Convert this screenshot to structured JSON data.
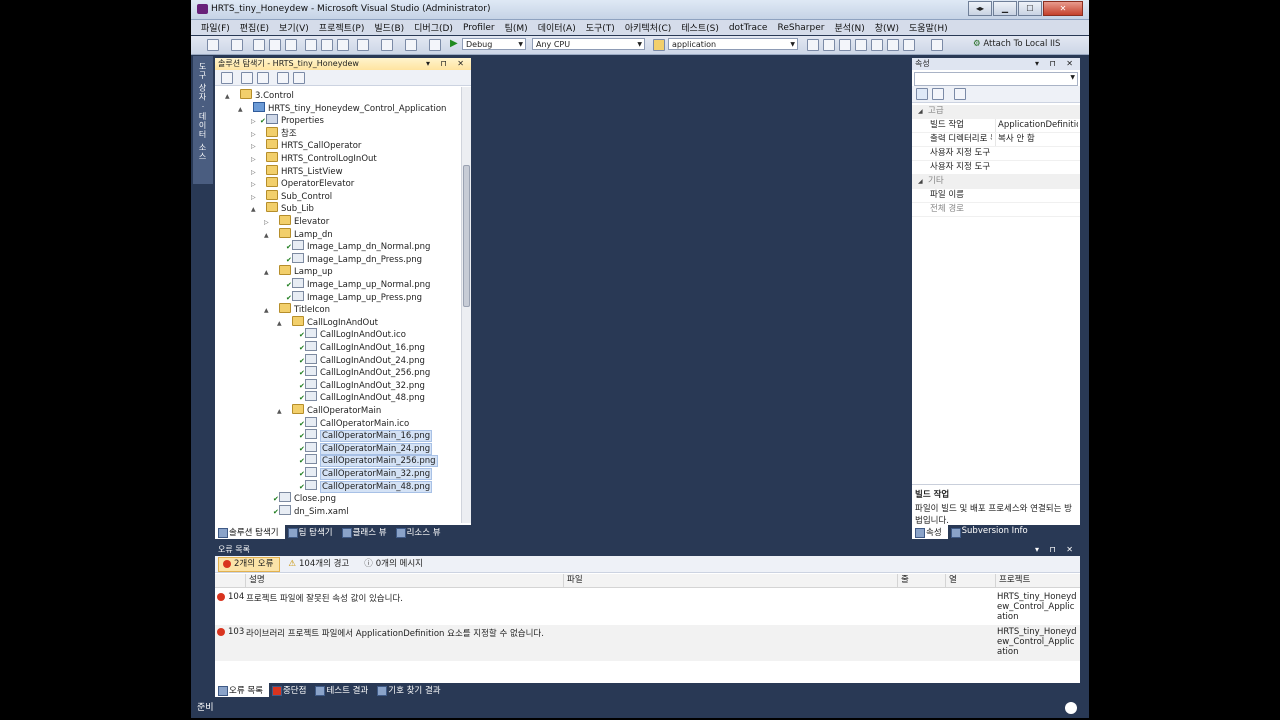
{
  "window": {
    "title": "HRTS_tiny_Honeydew - Microsoft Visual Studio (Administrator)"
  },
  "menu": [
    "파일(F)",
    "편집(E)",
    "보기(V)",
    "프로젝트(P)",
    "빌드(B)",
    "디버그(D)",
    "Profiler",
    "팀(M)",
    "데이터(A)",
    "도구(T)",
    "아키텍처(C)",
    "테스트(S)",
    "dotTrace",
    "ReSharper",
    "분석(N)",
    "창(W)",
    "도움말(H)"
  ],
  "toolbar": {
    "config": "Debug",
    "platform": "Any CPU",
    "find": "application",
    "attach": "Attach To Local IIS"
  },
  "left_dock": {
    "label": "도구 상자 · 데이터 소스"
  },
  "solution_explorer": {
    "title": "솔루션 탐색기 - HRTS_tiny_Honeydew",
    "items": [
      {
        "label": "3.Control",
        "level": 1,
        "icon": "folder",
        "exp": "▲",
        "chk": ""
      },
      {
        "label": "HRTS_tiny_Honeydew_Control_Application",
        "level": 2,
        "icon": "proj",
        "exp": "▲",
        "chk": ""
      },
      {
        "label": "Properties",
        "level": 3,
        "icon": "props",
        "exp": "▷",
        "chk": "✔"
      },
      {
        "label": "참조",
        "level": 3,
        "icon": "folder",
        "exp": "▷",
        "chk": ""
      },
      {
        "label": "HRTS_CallOperator",
        "level": 3,
        "icon": "folder",
        "exp": "▷",
        "chk": ""
      },
      {
        "label": "HRTS_ControlLogInOut",
        "level": 3,
        "icon": "folder",
        "exp": "▷",
        "chk": ""
      },
      {
        "label": "HRTS_ListView",
        "level": 3,
        "icon": "folder",
        "exp": "▷",
        "chk": ""
      },
      {
        "label": "OperatorElevator",
        "level": 3,
        "icon": "folder",
        "exp": "▷",
        "chk": ""
      },
      {
        "label": "Sub_Control",
        "level": 3,
        "icon": "folder",
        "exp": "▷",
        "chk": ""
      },
      {
        "label": "Sub_Lib",
        "level": 3,
        "icon": "folder",
        "exp": "▲",
        "chk": ""
      },
      {
        "label": "Elevator",
        "level": 4,
        "icon": "folder",
        "exp": "▷",
        "chk": ""
      },
      {
        "label": "Lamp_dn",
        "level": 4,
        "icon": "folder",
        "exp": "▲",
        "chk": ""
      },
      {
        "label": "Image_Lamp_dn_Normal.png",
        "level": 5,
        "icon": "file",
        "exp": "",
        "chk": "✔"
      },
      {
        "label": "Image_Lamp_dn_Press.png",
        "level": 5,
        "icon": "file",
        "exp": "",
        "chk": "✔"
      },
      {
        "label": "Lamp_up",
        "level": 4,
        "icon": "folder",
        "exp": "▲",
        "chk": ""
      },
      {
        "label": "Image_Lamp_up_Normal.png",
        "level": 5,
        "icon": "file",
        "exp": "",
        "chk": "✔"
      },
      {
        "label": "Image_Lamp_up_Press.png",
        "level": 5,
        "icon": "file",
        "exp": "",
        "chk": "✔"
      },
      {
        "label": "TitleIcon",
        "level": 4,
        "icon": "folder",
        "exp": "▲",
        "chk": ""
      },
      {
        "label": "CallLogInAndOut",
        "level": 5,
        "icon": "folder",
        "exp": "▲",
        "chk": ""
      },
      {
        "label": "CallLogInAndOut.ico",
        "level": 6,
        "icon": "file",
        "exp": "",
        "chk": "✔"
      },
      {
        "label": "CallLogInAndOut_16.png",
        "level": 6,
        "icon": "file",
        "exp": "",
        "chk": "✔"
      },
      {
        "label": "CallLogInAndOut_24.png",
        "level": 6,
        "icon": "file",
        "exp": "",
        "chk": "✔"
      },
      {
        "label": "CallLogInAndOut_256.png",
        "level": 6,
        "icon": "file",
        "exp": "",
        "chk": "✔"
      },
      {
        "label": "CallLogInAndOut_32.png",
        "level": 6,
        "icon": "file",
        "exp": "",
        "chk": "✔"
      },
      {
        "label": "CallLogInAndOut_48.png",
        "level": 6,
        "icon": "file",
        "exp": "",
        "chk": "✔"
      },
      {
        "label": "CallOperatorMain",
        "level": 5,
        "icon": "folder",
        "exp": "▲",
        "chk": ""
      },
      {
        "label": "CallOperatorMain.ico",
        "level": 6,
        "icon": "file",
        "exp": "",
        "chk": "✔"
      },
      {
        "label": "CallOperatorMain_16.png",
        "level": 6,
        "icon": "file",
        "exp": "",
        "chk": "✔",
        "sel": true
      },
      {
        "label": "CallOperatorMain_24.png",
        "level": 6,
        "icon": "file",
        "exp": "",
        "chk": "✔",
        "sel": true
      },
      {
        "label": "CallOperatorMain_256.png",
        "level": 6,
        "icon": "file",
        "exp": "",
        "chk": "✔",
        "sel": true
      },
      {
        "label": "CallOperatorMain_32.png",
        "level": 6,
        "icon": "file",
        "exp": "",
        "chk": "✔",
        "sel": true
      },
      {
        "label": "CallOperatorMain_48.png",
        "level": 6,
        "icon": "file",
        "exp": "",
        "chk": "✔",
        "sel": true
      },
      {
        "label": "Close.png",
        "level": 4,
        "icon": "file",
        "exp": "",
        "chk": "✔"
      },
      {
        "label": "dn_Sim.xaml",
        "level": 4,
        "icon": "file",
        "exp": "",
        "chk": "✔"
      }
    ],
    "tabs": [
      "솔루션 탐색기",
      "팀 탐색기",
      "클래스 뷰",
      "리소스 뷰"
    ]
  },
  "properties": {
    "title": "속성",
    "rows": [
      {
        "type": "cat",
        "key": "고급",
        "value": ""
      },
      {
        "type": "prop",
        "key": "빌드 작업",
        "value": "ApplicationDefinition"
      },
      {
        "type": "prop",
        "key": "출력 디렉터리로 복사",
        "value": "복사 안 함"
      },
      {
        "type": "prop",
        "key": "사용자 지정 도구",
        "value": ""
      },
      {
        "type": "prop",
        "key": "사용자 지정 도구 네임스페이스",
        "value": ""
      },
      {
        "type": "cat",
        "key": "기타",
        "value": ""
      },
      {
        "type": "prop",
        "key": "파일 이름",
        "value": ""
      },
      {
        "type": "dim",
        "key": "전체 경로",
        "value": ""
      }
    ],
    "desc_title": "빌드 작업",
    "desc_text": "파일이 빌드 및 배포 프로세스와 연결되는 방법입니다.",
    "tabs": [
      "속성",
      "Subversion Info"
    ]
  },
  "error_list": {
    "title": "오류 목록",
    "filters": {
      "errors": "2개의 오류",
      "warnings": "104개의 경고",
      "messages": "0개의 메시지"
    },
    "columns": {
      "desc": "설명",
      "file": "파일",
      "line": "줄",
      "col": "열",
      "project": "프로젝트"
    },
    "rows": [
      {
        "num": "104",
        "desc": "프로젝트 파일에 잘못된 속성 값이 있습니다.",
        "project": "HRTS_tiny_Honeydew_Control_Application"
      },
      {
        "num": "103",
        "desc": "라이브러리 프로젝트 파일에서 ApplicationDefinition 요소를 지정할 수 없습니다.",
        "project": "HRTS_tiny_Honeydew_Control_Application"
      }
    ],
    "tabs": [
      "오류 목록",
      "중단점",
      "테스트 결과",
      "기호 찾기 결과"
    ]
  },
  "status": {
    "text": "준비"
  },
  "colors": {
    "chrome": "#293955",
    "error": "#d9341f",
    "warning": "#e8b418"
  }
}
